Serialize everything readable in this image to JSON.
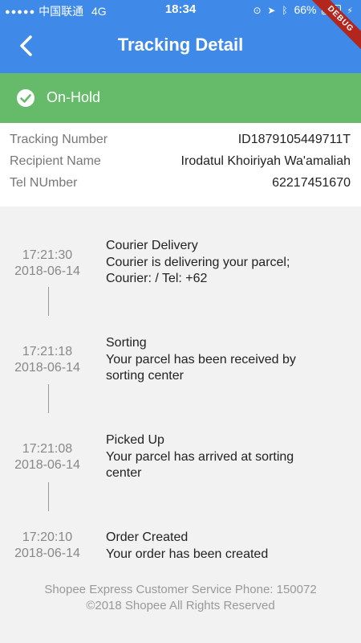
{
  "status_bar": {
    "carrier": "中国联通",
    "network": "4G",
    "time": "18:34",
    "battery_percent": "66%",
    "battery_level": 0.66
  },
  "app_bar": {
    "title": "Tracking Detail",
    "debug_label": "DEBUG"
  },
  "status_banner": {
    "label": "On-Hold",
    "color": "#66bb6a"
  },
  "details": [
    {
      "label": "Tracking Number",
      "value": "ID1879105449711T"
    },
    {
      "label": "Recipient Name",
      "value": "Irodatul Khoiriyah Wa'amaliah"
    },
    {
      "label": "Tel NUmber",
      "value": "62217451670"
    }
  ],
  "timeline": [
    {
      "time": "17:21:30",
      "date": "2018-06-14",
      "title": "Courier Delivery",
      "line1": "Courier is delivering your parcel;",
      "line2": "Courier:  / Tel: +62"
    },
    {
      "time": "17:21:18",
      "date": "2018-06-14",
      "title": "Sorting",
      "line1": "Your parcel has been received by",
      "line2": "sorting center"
    },
    {
      "time": "17:21:08",
      "date": "2018-06-14",
      "title": "Picked Up",
      "line1": "Your parcel has arrived at sorting",
      "line2": "center"
    },
    {
      "time": "17:20:10",
      "date": "2018-06-14",
      "title": "Order Created",
      "line1": "Your order has been created",
      "line2": ""
    }
  ],
  "footer": {
    "line1": "Shopee Express Customer Service Phone: 150072",
    "line2": "©2018 Shopee All Rights Reserved"
  },
  "colors": {
    "app_bar": "#3f8ae8",
    "banner": "#66bb6a",
    "debug": "#b3261e"
  }
}
